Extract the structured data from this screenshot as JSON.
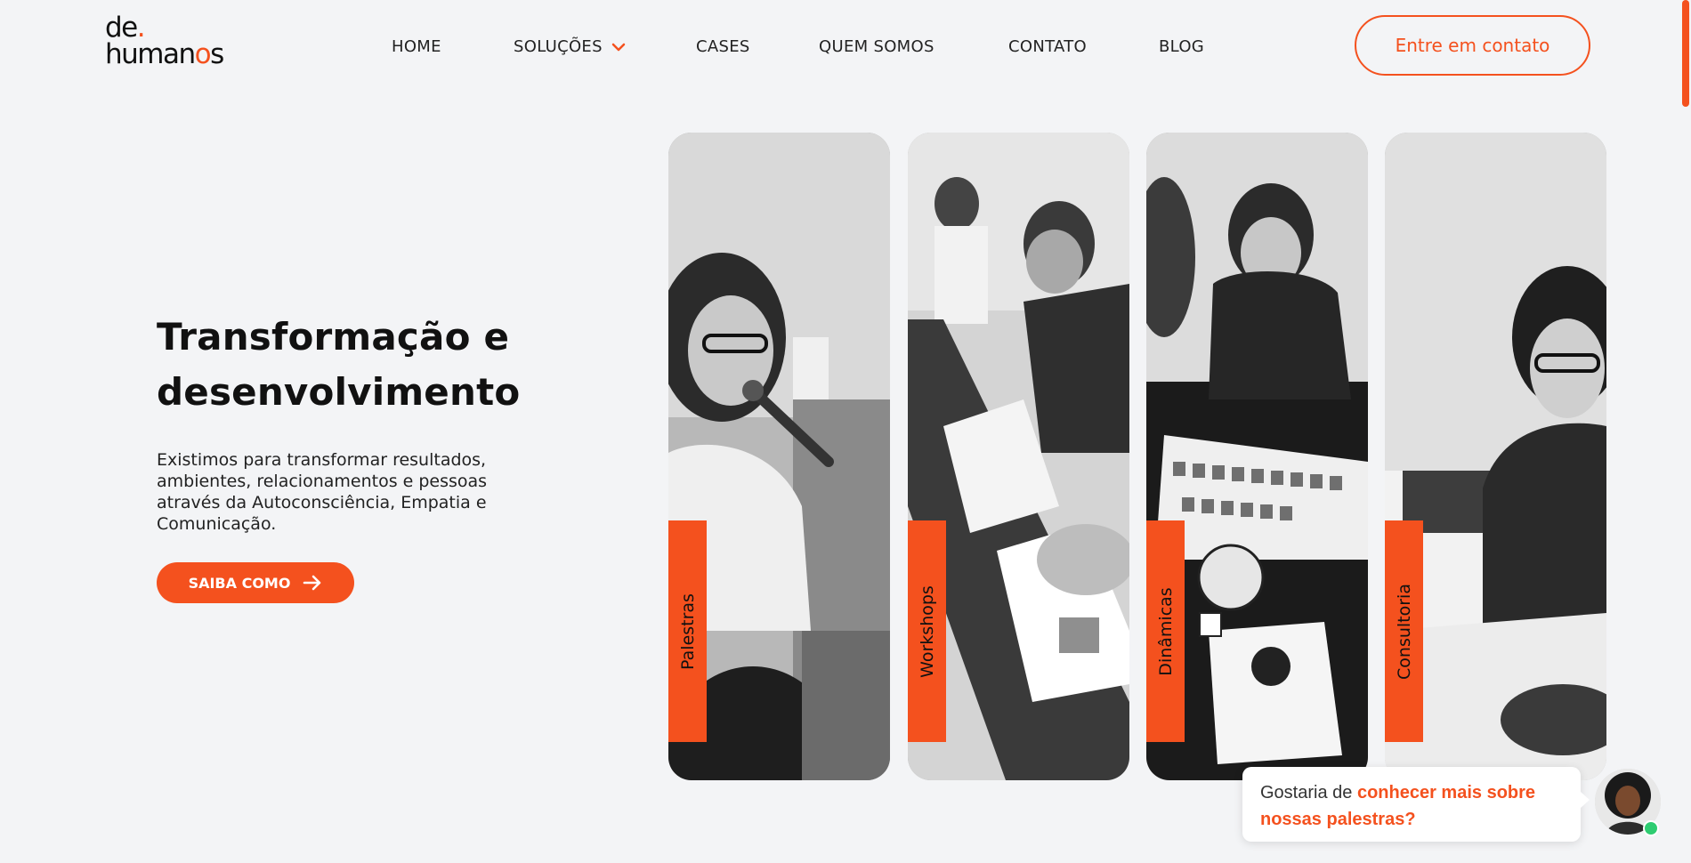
{
  "header": {
    "logo": {
      "line1": "de",
      "line1_dot": ".",
      "line2_a": "human",
      "line2_b": "o",
      "line2_c": "s"
    },
    "nav": [
      {
        "label": "HOME"
      },
      {
        "label": "SOLUÇÕES",
        "has_dropdown": true,
        "icon": "chevron-down-icon"
      },
      {
        "label": "CASES"
      },
      {
        "label": "QUEM SOMOS"
      },
      {
        "label": "CONTATO"
      },
      {
        "label": "BLOG"
      }
    ],
    "cta_label": "Entre em contato"
  },
  "hero": {
    "title_line1": "Transformação e",
    "title_line2": "desenvolvimento",
    "description": "Existimos para transformar resultados, ambientes, relacionamentos e pessoas através da Autoconsciência, Empatia e Comunicação.",
    "button_label": "SAIBA COMO",
    "button_icon": "arrow-right-icon"
  },
  "cards": [
    {
      "label": "Palestras"
    },
    {
      "label": "Workshops"
    },
    {
      "label": "Dinâmicas"
    },
    {
      "label": "Consultoria"
    }
  ],
  "chat": {
    "prefix": "Gostaria de ",
    "highlight": "conhecer mais sobre nossas palestras?",
    "status": "online"
  },
  "colors": {
    "accent": "#f4511e",
    "background": "#f3f4f6",
    "text": "#111111",
    "online": "#2ecc71"
  }
}
